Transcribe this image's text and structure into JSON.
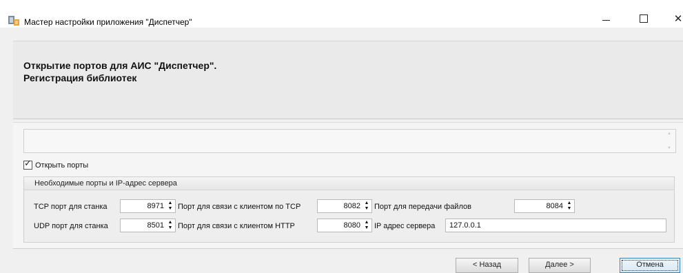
{
  "window": {
    "title": "Мастер настройки приложения \"Диспетчер\"",
    "close_glyph": "✕"
  },
  "header": {
    "title_line1": "Открытие портов для АИС \"Диспетчер\".",
    "title_line2": "Регистрация библиотек"
  },
  "content": {
    "status_text": "",
    "open_ports": {
      "label": "Открыть порты",
      "checked": true
    },
    "group": {
      "title": "Необходимые порты и IP-адрес сервера",
      "tcp_machine": {
        "label": "TCP порт для станка",
        "value": "8971"
      },
      "udp_machine": {
        "label": "UDP порт для станка",
        "value": "8501"
      },
      "client_tcp": {
        "label": "Порт для связи с клиентом по TCP",
        "value": "8082"
      },
      "client_http": {
        "label": "Порт для связи с клиентом HTTP",
        "value": "8080"
      },
      "file_transfer": {
        "label": "Порт для передачи файлов",
        "value": "8084"
      },
      "server_ip": {
        "label": "IP адрес сервера",
        "value": "127.0.0.1"
      }
    }
  },
  "buttons": {
    "back": "< Назад",
    "next": "Далее >",
    "cancel": "Отмена"
  },
  "icons": {
    "app": "app-icon",
    "spin_up": "▲",
    "spin_down": "▼",
    "checkmark": "✓"
  }
}
